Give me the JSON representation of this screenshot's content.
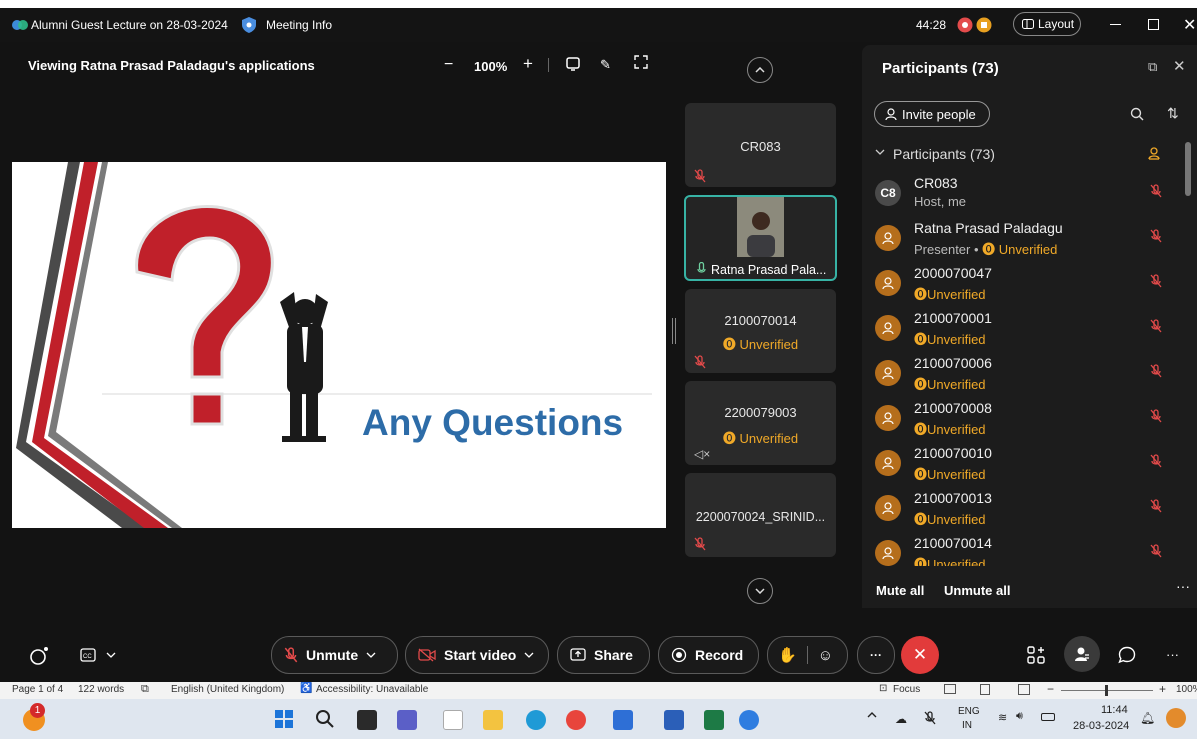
{
  "titlebar": {
    "meeting_title": "Alumni Guest Lecture on 28-03-2024",
    "meeting_info": "Meeting Info",
    "timer": "44:28",
    "layout_label": "Layout"
  },
  "share": {
    "viewing_text": "Viewing Ratna Prasad Paladagu's applications",
    "zoom": "100%",
    "slide_title": "Any Questions"
  },
  "tiles": [
    {
      "name": "CR083",
      "status": ""
    },
    {
      "name": "Ratna Prasad Pala...",
      "status": ""
    },
    {
      "name": "2100070014",
      "status": "Unverified"
    },
    {
      "name": "2200079003",
      "status": "Unverified"
    },
    {
      "name": "2200070024_SRINID...",
      "status": ""
    }
  ],
  "participants_panel": {
    "title": "Participants (73)",
    "invite_label": "Invite people",
    "section_label": "Participants (73)",
    "mute_all": "Mute all",
    "unmute_all": "Unmute all",
    "list": [
      {
        "name": "CR083",
        "sub": "Host, me",
        "avatar": "C8"
      },
      {
        "name": "Ratna Prasad Paladagu",
        "sub_role": "Presenter",
        "sub": "Unverified"
      },
      {
        "name": "2000070047",
        "sub": "Unverified"
      },
      {
        "name": "2100070001",
        "sub": "Unverified"
      },
      {
        "name": "2100070006",
        "sub": "Unverified"
      },
      {
        "name": "2100070008",
        "sub": "Unverified"
      },
      {
        "name": "2100070010",
        "sub": "Unverified"
      },
      {
        "name": "2100070013",
        "sub": "Unverified"
      },
      {
        "name": "2100070014",
        "sub": "Unverified"
      }
    ]
  },
  "controls": {
    "unmute": "Unmute",
    "start_video": "Start video",
    "share": "Share",
    "record": "Record"
  },
  "wordbar": {
    "page": "Page 1 of 4",
    "words": "122 words",
    "language": "English (United Kingdom)",
    "accessibility": "Accessibility: Unavailable",
    "focus": "Focus",
    "zoom": "100%"
  },
  "taskbar": {
    "lang_top": "ENG",
    "lang_bottom": "IN",
    "time": "11:44",
    "date": "28-03-2024",
    "notification_count": "1"
  },
  "colors": {
    "accent_red": "#e24a4a",
    "unverified": "#f0a928",
    "slide_blue": "#2d6ca8",
    "tile_active": "#37b3a5"
  }
}
